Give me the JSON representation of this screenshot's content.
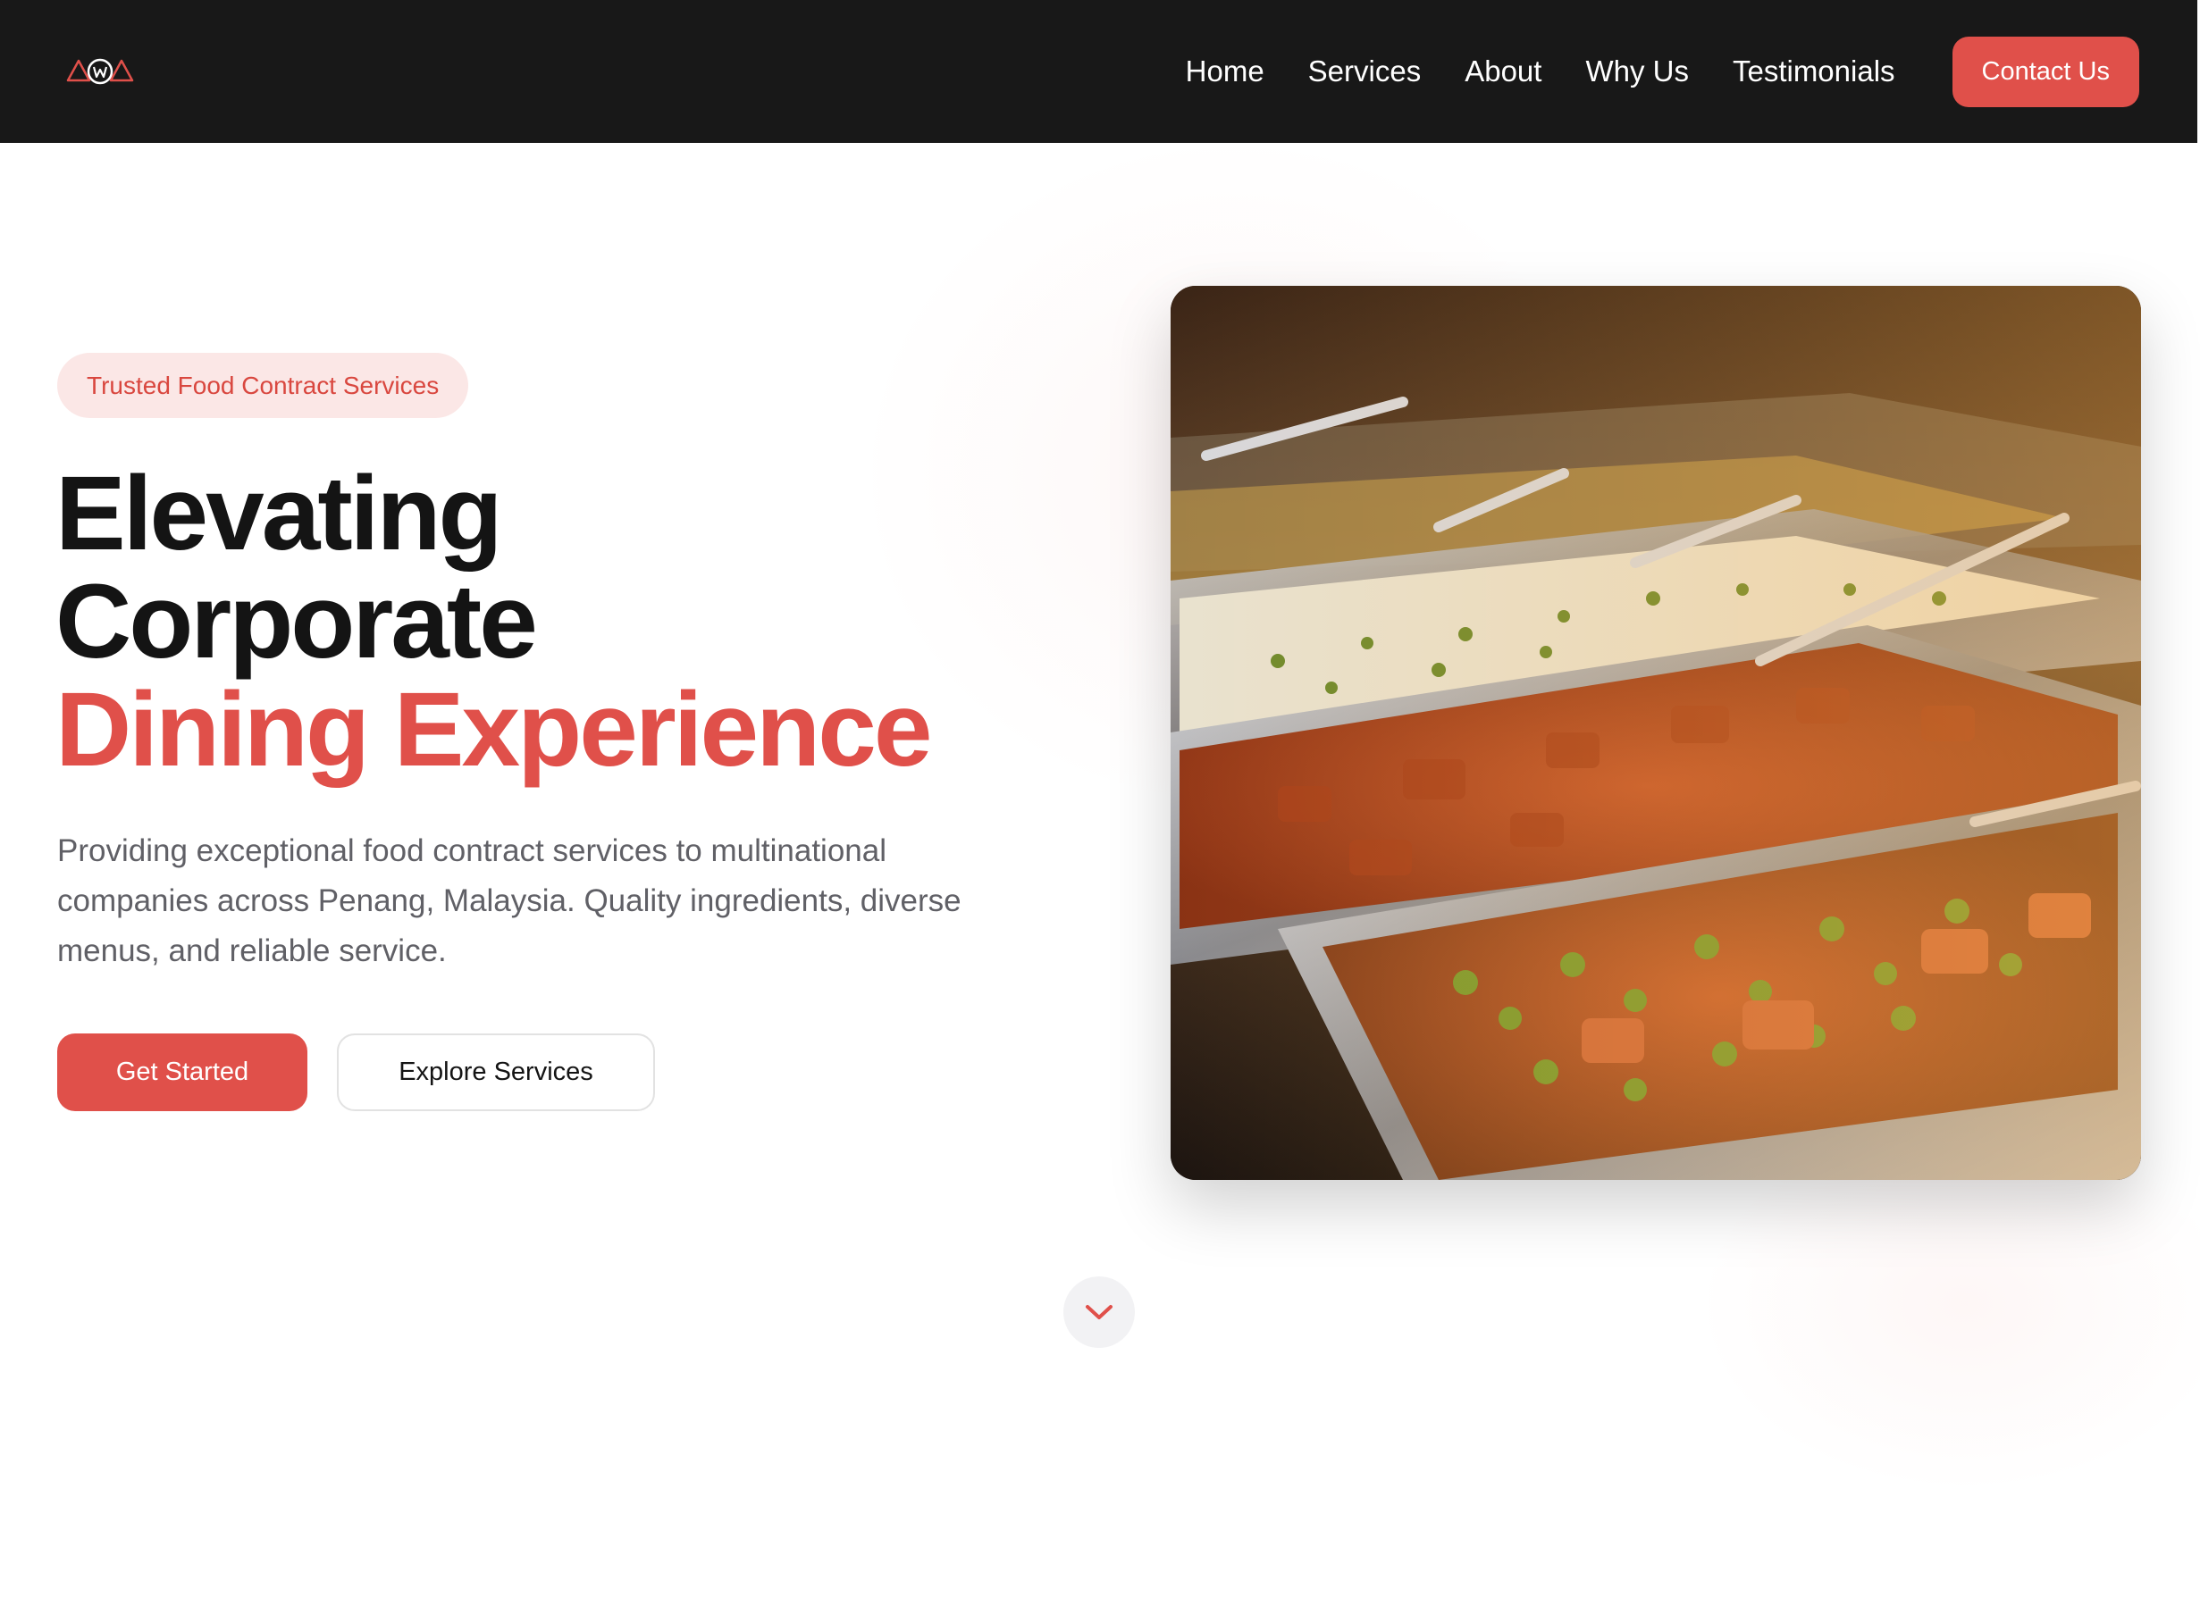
{
  "nav": {
    "logo_name": "brand-logo",
    "links": [
      "Home",
      "Services",
      "About",
      "Why Us",
      "Testimonials"
    ],
    "cta": "Contact Us"
  },
  "hero": {
    "badge": "Trusted Food Contract Services",
    "title_line1": "Elevating",
    "title_line2": "Corporate",
    "title_line3": "Dining Experience",
    "description": "Providing exceptional food contract services to multinational companies across Penang, Malaysia. Quality ingredients, diverse menus, and reliable service.",
    "primary_button": "Get Started",
    "secondary_button": "Explore Services",
    "image_subject": "buffet trays of curry, rice and peas"
  },
  "scroll": {
    "icon": "chevron-down-icon"
  },
  "colors": {
    "accent": "#e0504a",
    "nav_bg": "#181818",
    "badge_bg": "#fbe7e6",
    "heading": "#141414",
    "body_text": "#606066"
  }
}
